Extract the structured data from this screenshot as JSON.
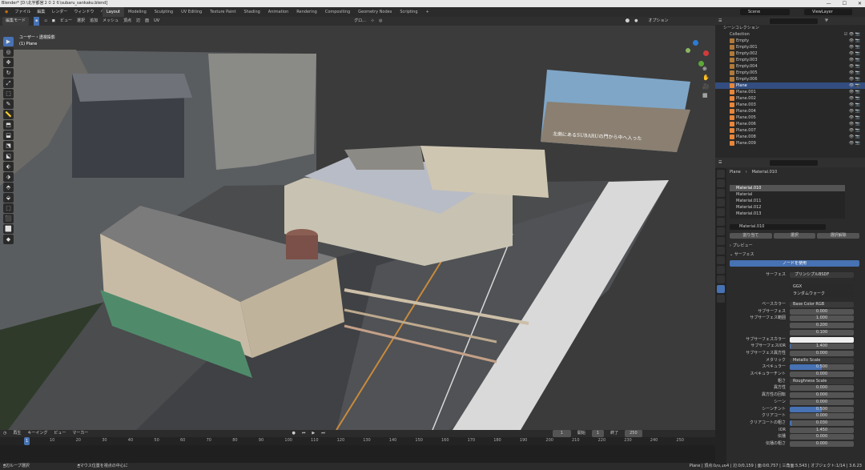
{
  "title": "Blender* [D:\\北宇都宮２０２６\\subaru_sankaku.blend]",
  "window_buttons": [
    "—",
    "☐",
    "✕"
  ],
  "menus": [
    "ファイル",
    "編集",
    "レンダー",
    "ウィンドウ",
    "ヘルプ"
  ],
  "workspaces": [
    "Layout",
    "Modeling",
    "Sculpting",
    "UV Editing",
    "Texture Paint",
    "Shading",
    "Animation",
    "Rendering",
    "Compositing",
    "Geometry Nodes",
    "Scripting"
  ],
  "active_workspace": "Layout",
  "scene": "Scene",
  "view_layer": "ViewLayer",
  "viewport": {
    "mode": "編集モード",
    "menus": [
      "ビュー",
      "選択",
      "追加",
      "メッシュ",
      "頂点",
      "辺",
      "面",
      "UV"
    ],
    "orientation": "グロ...",
    "options": "オプション",
    "view_name": "ユーザー・透視投影",
    "object_name": "(1) Plane",
    "caption": "北側にあるSUBARUの門から中へ入った"
  },
  "tools": [
    "▶",
    "◎",
    "✥",
    "↻",
    "⤢",
    "⬚",
    "✎",
    "📏",
    "⬒",
    "⬓",
    "⬔",
    "⬕",
    "⬖",
    "⬗",
    "⬘",
    "⬙",
    "⬚",
    "⬛",
    "⬜",
    "◆",
    "◇",
    "▲",
    "▼"
  ],
  "timeline": {
    "menus": [
      "再生",
      "キーイング",
      "ビュー",
      "マーカー"
    ],
    "current_frame": "1",
    "start_label": "開始",
    "start": "1",
    "end_label": "終了",
    "end": "250",
    "ticks": [
      "10",
      "20",
      "30",
      "40",
      "50",
      "60",
      "70",
      "80",
      "90",
      "100",
      "110",
      "120",
      "130",
      "140",
      "150",
      "160",
      "170",
      "180",
      "190",
      "200",
      "210",
      "220",
      "230",
      "240",
      "250"
    ]
  },
  "status": {
    "left1": "辺ループ選択",
    "left2": "マウス位置を視点の中心に",
    "right": "Plane | 頂点:0/0,164 | 辺:0/0,159 | 面:0/0,757 | 三角面:5,543 | オブジェクト:1/14 | 3.6.23"
  },
  "outliner": {
    "root": "シーンコレクション",
    "collection": "Collection",
    "items": [
      {
        "name": "Empty",
        "type": "empty"
      },
      {
        "name": "Empty.001",
        "type": "empty"
      },
      {
        "name": "Empty.002",
        "type": "empty"
      },
      {
        "name": "Empty.003",
        "type": "empty"
      },
      {
        "name": "Empty.004",
        "type": "empty"
      },
      {
        "name": "Empty.005",
        "type": "empty"
      },
      {
        "name": "Empty.006",
        "type": "empty"
      },
      {
        "name": "Plane",
        "type": "mesh",
        "selected": true
      },
      {
        "name": "Plane.001",
        "type": "mesh"
      },
      {
        "name": "Plane.002",
        "type": "mesh"
      },
      {
        "name": "Plane.003",
        "type": "mesh"
      },
      {
        "name": "Plane.004",
        "type": "mesh"
      },
      {
        "name": "Plane.005",
        "type": "mesh"
      },
      {
        "name": "Plane.006",
        "type": "mesh"
      },
      {
        "name": "Plane.007",
        "type": "mesh"
      },
      {
        "name": "Plane.008",
        "type": "mesh"
      },
      {
        "name": "Plane.009",
        "type": "mesh"
      }
    ]
  },
  "properties": {
    "breadcrumb_object": "Plane",
    "breadcrumb_material": "Material.010",
    "slots": [
      "Material.010",
      "Material",
      "Material.011",
      "Material.012",
      "Material.013"
    ],
    "material_name": "Material.010",
    "assign": "割り当て",
    "select": "選択",
    "deselect": "選択解除",
    "preview": "プレビュー",
    "surface": "サーフェス",
    "use_nodes": "ノードを使用",
    "surface_label": "サーフェス",
    "surface_shader": "プリンシプルBSDF",
    "distribution": "GGX",
    "subsurface_method": "ランダムウォーク",
    "rows": [
      {
        "label": "ベースカラー",
        "value": "Base Color RGB",
        "kind": "link"
      },
      {
        "label": "サブサーフェス",
        "value": "0.000"
      },
      {
        "label": "サブサーフェス範囲",
        "value": "1.000"
      },
      {
        "label": "",
        "value": "0.200"
      },
      {
        "label": "",
        "value": "0.100"
      },
      {
        "label": "サブサーフェスカラー",
        "value": "",
        "kind": "color"
      },
      {
        "label": "サブサーフェスIOR",
        "value": "1.400",
        "fill": 0.02
      },
      {
        "label": "サブサーフェス異方性",
        "value": "0.000"
      },
      {
        "label": "メタリック",
        "value": "Metallic Scale",
        "kind": "link"
      },
      {
        "label": "スペキュラー",
        "value": "0.500",
        "fill": 0.5
      },
      {
        "label": "スペキュラーチント",
        "value": "0.000"
      },
      {
        "label": "粗さ",
        "value": "Roughness Scale",
        "kind": "link"
      },
      {
        "label": "異方性",
        "value": "0.000"
      },
      {
        "label": "異方性の回転",
        "value": "0.000"
      },
      {
        "label": "シーン",
        "value": "0.000"
      },
      {
        "label": "シーンチント",
        "value": "0.500",
        "fill": 0.5
      },
      {
        "label": "クリアコート",
        "value": "0.000"
      },
      {
        "label": "クリアコートの粗さ",
        "value": "0.030",
        "fill": 0.03
      },
      {
        "label": "IOR",
        "value": "1.450"
      },
      {
        "label": "伝播",
        "value": "0.000"
      },
      {
        "label": "伝播の粗さ",
        "value": "0.000"
      }
    ]
  }
}
